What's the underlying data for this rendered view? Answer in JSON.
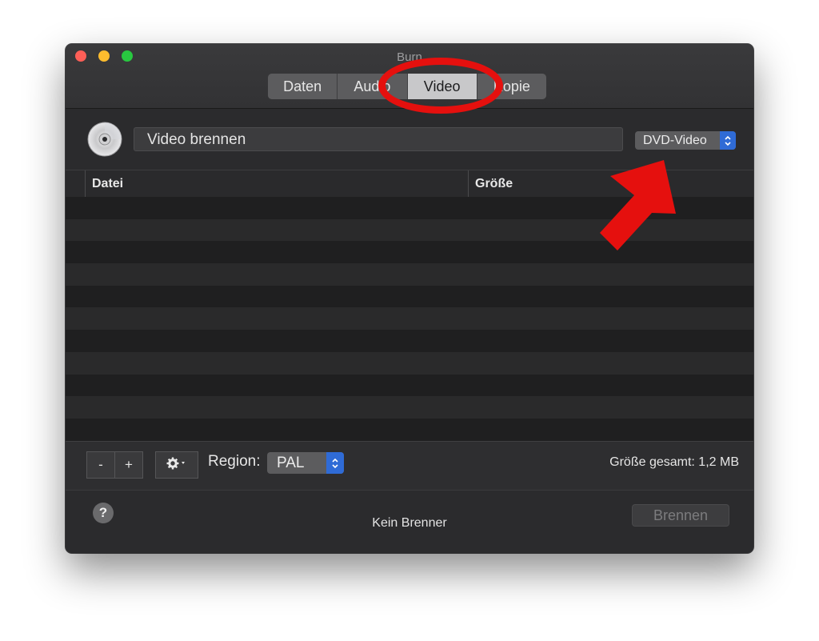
{
  "window": {
    "title": "Burn"
  },
  "tabs": [
    {
      "label": "Daten",
      "active": false
    },
    {
      "label": "Audio",
      "active": false
    },
    {
      "label": "Video",
      "active": true
    },
    {
      "label": "Kopie",
      "active": false
    }
  ],
  "header": {
    "disc_icon": "disc-icon",
    "name_value": "Video brennen",
    "format_selected": "DVD-Video"
  },
  "table": {
    "columns": [
      "Datei",
      "Größe"
    ],
    "rows": []
  },
  "bottombar": {
    "remove_label": "-",
    "add_label": "+",
    "gear_icon": "gear-icon",
    "region_label": "Region:",
    "region_value": "PAL",
    "total_size": "Größe gesamt: 1,2 MB"
  },
  "footer": {
    "help_label": "?",
    "status": "Kein Brenner",
    "burn_label": "Brennen"
  },
  "colors": {
    "annotation": "#e5100e",
    "accent": "#2f6bd6"
  }
}
